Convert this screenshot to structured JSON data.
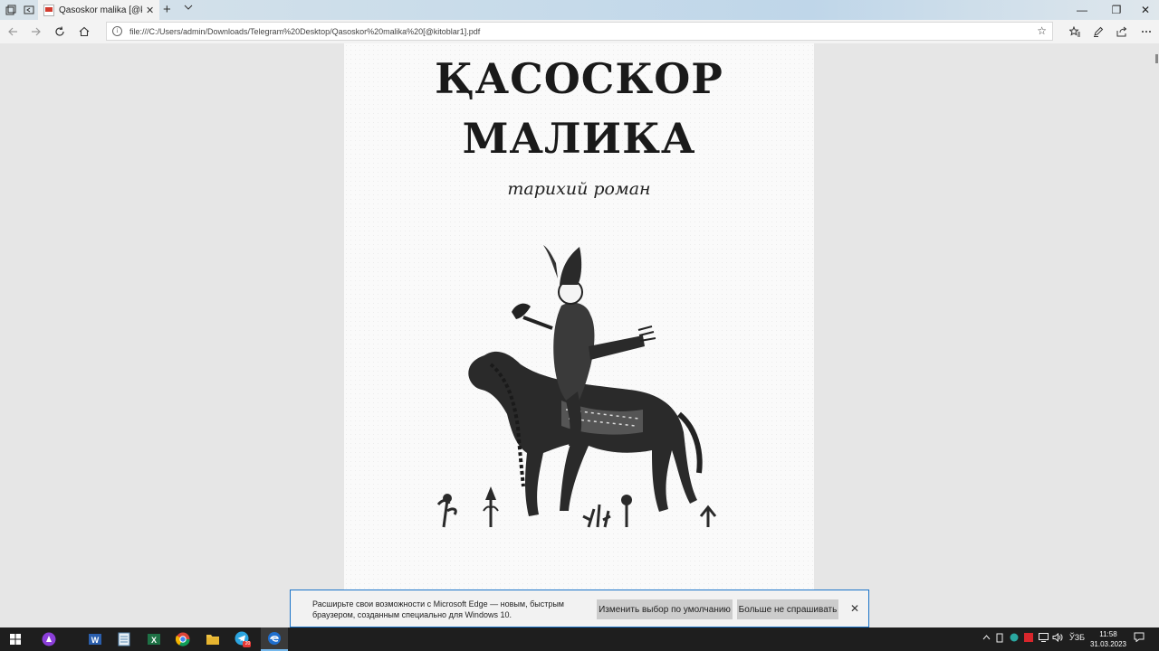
{
  "browser": {
    "tab_title": "Qasoskor malika [@kito",
    "tab_close": "✕",
    "new_tab": "+",
    "address": "file:///C:/Users/admin/Downloads/Telegram%20Desktop/Qasoskor%20malika%20[@kitoblar1].pdf",
    "icons": [
      "tab-manager-icon",
      "set-aside-icon",
      "pdf-icon",
      "back-icon",
      "forward-icon",
      "refresh-icon",
      "home-icon",
      "info-icon",
      "favorite-star-icon",
      "favorites-icon",
      "pen-icon",
      "share-icon",
      "more-icon"
    ],
    "window_controls": {
      "minimize": "—",
      "restore": "❐",
      "close": "✕"
    }
  },
  "document": {
    "title_line1": "ҚАСОСКОР",
    "title_line2": "МАЛИКА",
    "subtitle": "тарихий роман"
  },
  "notification": {
    "message": "Расширьте свои возможности с Microsoft Edge — новым, быстрым браузером, созданным специально для Windows 10.",
    "button_default": "Изменить выбор по умолчанию",
    "button_dismiss": "Больше не спрашивать",
    "close": "✕"
  },
  "taskbar": {
    "apps": [
      "start-icon",
      "alice-icon",
      "word-icon",
      "notepad-icon",
      "excel-icon",
      "chrome-icon",
      "explorer-icon",
      "telegram-icon",
      "edge-icon"
    ],
    "telegram_badge": "20",
    "language": "ЎЗБ",
    "time": "11:58",
    "date": "31.03.2023"
  },
  "colors": {
    "accent": "#1a73c9",
    "taskbar": "#1e1e1e",
    "page_bg": "#fafafa"
  }
}
